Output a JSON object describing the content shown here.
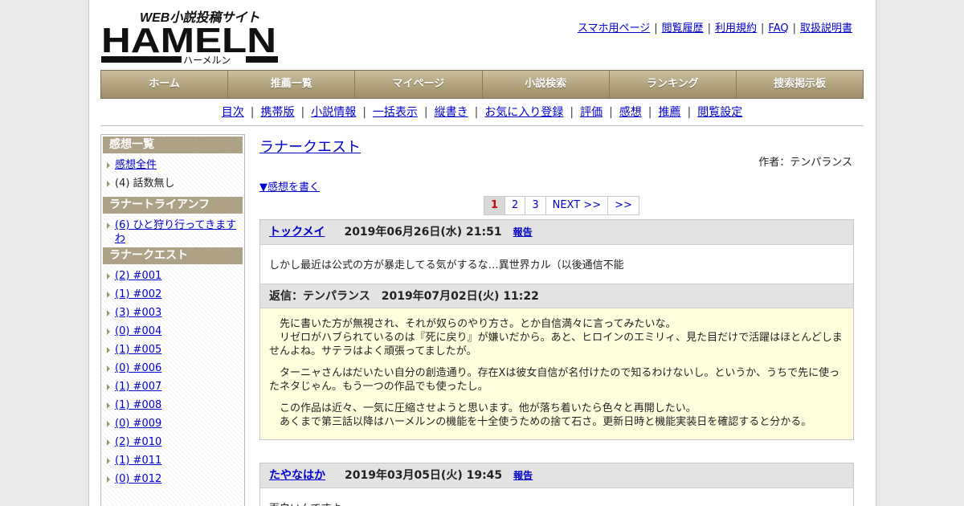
{
  "logo": {
    "tagline": "WEB小説投稿サイト",
    "wordmark": "HAMELN",
    "kana": "ハーメルン"
  },
  "toplinks": [
    "スマホ用ページ",
    "閲覧履歴",
    "利用規約",
    "FAQ",
    "取扱説明書"
  ],
  "gnav": [
    "ホーム",
    "推薦一覧",
    "マイページ",
    "小説検索",
    "ランキング",
    "捜索掲示板"
  ],
  "subnav": [
    "目次",
    "携帯版",
    "小説情報",
    "一括表示",
    "縦書き",
    "お気に入り登録",
    "評価",
    "感想",
    "推薦",
    "閲覧設定"
  ],
  "sidebar": {
    "sections": [
      {
        "heading": "感想一覧",
        "items": [
          "感想全件",
          "(4) 話数無し"
        ]
      },
      {
        "heading": "ラナートライアンフ",
        "items": [
          "(6) ひと狩り行ってきますわ"
        ]
      },
      {
        "heading": "ラナークエスト",
        "items": [
          "(2) #001",
          "(1) #002",
          "(3) #003",
          "(0) #004",
          "(1) #005",
          "(0) #006",
          "(1) #007",
          "(1) #008",
          "(0) #009",
          "(2) #010",
          "(1) #011",
          "(0) #012"
        ]
      }
    ]
  },
  "main": {
    "novel_title": "ラナークエスト",
    "author": "作者：テンパランス",
    "write_link": "▼感想を書く",
    "pager": [
      "1",
      "2",
      "3",
      "NEXT >>",
      ">>"
    ],
    "comments": [
      {
        "user": "トックメイ",
        "date": "2019年06月26日(水) 21:51",
        "report": "報告",
        "body": "しかし最近は公式の方が暴走してる気がするな…異世界カル（以後通信不能",
        "reply_head": "返信：テンパランス　2019年07月02日(火) 11:22",
        "reply": [
          "　先に書いた方が無視され、それが奴らのやり方さ。とか自信満々に言ってみたいな。",
          "　リゼロがハブられているのは『死に戻り』が嫌いだから。あと、ヒロインのエミリィ、見た目だけで活躍はほとんどしませんよね。サテラはよく頑張ってましたが。",
          "　ターニャさんはだいたい自分の創造通り。存在Xは彼女自信が名付けたので知るわけないし。というか、うちで先に使ったネタじゃん。もう一つの作品でも使ったし。",
          "　この作品は近々、一気に圧縮させようと思います。他が落ち着いたら色々と再開したい。",
          "　あくまで第三話以降はハーメルンの機能を十全使うための捨て石さ。更新日時と機能実装日を確認すると分かる。"
        ]
      },
      {
        "user": "たやなはか",
        "date": "2019年03月05日(火) 19:45",
        "report": "報告",
        "body": "面白いんですよ"
      }
    ]
  }
}
